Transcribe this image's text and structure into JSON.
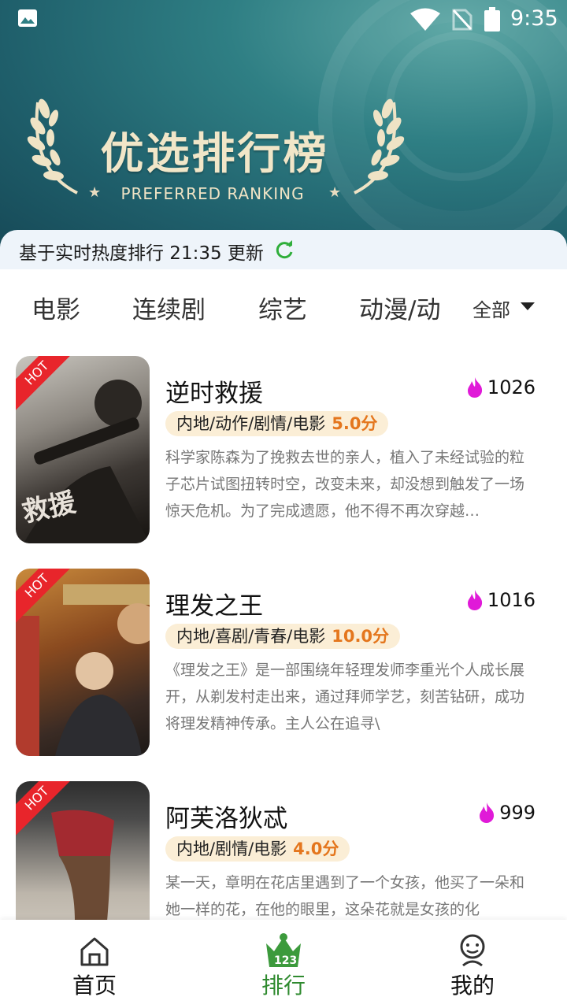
{
  "status_bar": {
    "time": "9:35"
  },
  "banner": {
    "title_zh": "优选排行榜",
    "title_en": "PREFERRED RANKING"
  },
  "update_text": "基于实时热度排行 21:35 更新",
  "tabs": [
    {
      "label": "电影"
    },
    {
      "label": "连续剧"
    },
    {
      "label": "综艺"
    },
    {
      "label": "动漫/动"
    }
  ],
  "filter": {
    "label": "全部"
  },
  "items": [
    {
      "hot": "HOT",
      "title": "逆时救援",
      "heat": "1026",
      "tags": "内地/动作/剧情/电影",
      "score": "5.0分",
      "desc": "科学家陈森为了挽救去世的亲人，植入了未经试验的粒子芯片试图扭转时空，改变未来，却没想到触发了一场惊天危机。为了完成遗愿，他不得不再次穿越…",
      "poster_colors": [
        "#b4b2ad",
        "#5a5550",
        "#1d1a17"
      ]
    },
    {
      "hot": "HOT",
      "title": "理发之王",
      "heat": "1016",
      "tags": "内地/喜剧/青春/电影",
      "score": "10.0分",
      "desc": "《理发之王》是一部围绕年轻理发师李重光个人成长展开，从剃发村走出来，通过拜师学艺，刻苦钻研，成功将理发精神传承。主人公在追寻\\",
      "poster_colors": [
        "#b1762e",
        "#6b3a1c",
        "#2a2320"
      ]
    },
    {
      "hot": "HOT",
      "title": "阿芙洛狄忒",
      "heat": "999",
      "tags": "内地/剧情/电影",
      "score": "4.0分",
      "desc": "某一天，章明在花店里遇到了一个女孩，他买了一朵和她一样的花，在他的眼里，这朵花就是女孩的化",
      "poster_colors": [
        "#3a3a3a",
        "#9a2b2b",
        "#d8d1c6"
      ]
    }
  ],
  "nav": [
    {
      "label": "首页"
    },
    {
      "label": "排行"
    },
    {
      "label": "我的"
    }
  ],
  "colors": {
    "accent_green": "#2f8a2f",
    "score_orange": "#e4761d",
    "hot_red": "#e8252b",
    "fire_magenta": "#e01ad8"
  }
}
